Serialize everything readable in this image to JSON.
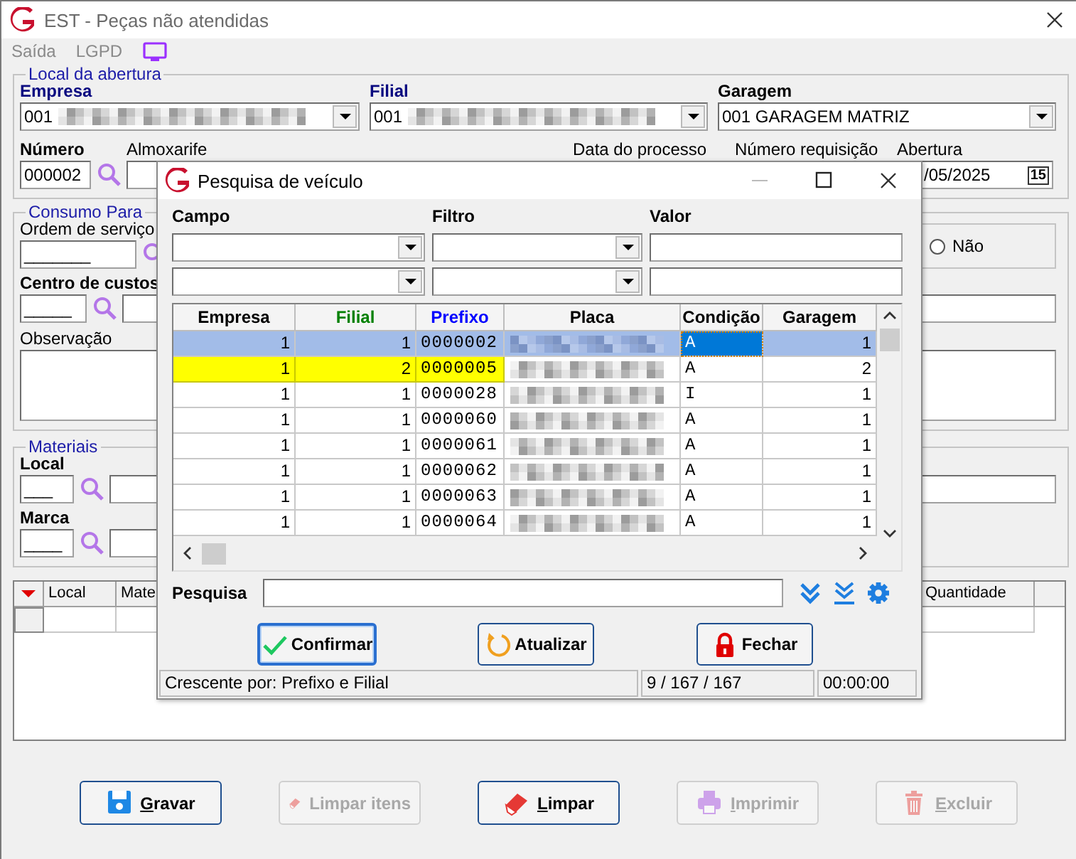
{
  "window": {
    "title": "EST - Peças não atendidas",
    "menu": [
      "Saída",
      "LGPD"
    ]
  },
  "local_da_abertura": {
    "title": "Local da abertura",
    "empresa": {
      "label": "Empresa",
      "value": "001"
    },
    "filial": {
      "label": "Filial",
      "value": "001"
    },
    "garagem": {
      "label": "Garagem",
      "value": "001 GARAGEM MATRIZ"
    },
    "numero": {
      "label": "Número",
      "value": "000002"
    },
    "almoxarife": {
      "label": "Almoxarife"
    },
    "data_do_processo": {
      "label": "Data do processo"
    },
    "numero_requisicao": {
      "label": "Número requisição"
    },
    "abertura": {
      "label": "Abertura",
      "value": "/05/2025",
      "calendar": "15"
    }
  },
  "consumo_para": {
    "title": "Consumo Para",
    "ordem_de_servico": {
      "label": "Ordem de serviço",
      "value": "_______"
    },
    "radio": {
      "label": "Não",
      "selected": false
    },
    "centro_de_custos": {
      "label": "Centro de custos",
      "value": "_____"
    },
    "observacao": {
      "label": "Observação"
    }
  },
  "materiais": {
    "title": "Materiais",
    "local": {
      "label": "Local",
      "value": "___"
    },
    "marca": {
      "label": "Marca",
      "value": "____"
    }
  },
  "items_table": {
    "columns": [
      "Local",
      "Mate",
      "Quantidade"
    ]
  },
  "buttons": [
    {
      "label": "Gravar",
      "kind": "save",
      "disabled": false,
      "accel": true
    },
    {
      "label": "Limpar itens",
      "kind": "eraser",
      "disabled": true,
      "accel": false
    },
    {
      "label": "Limpar",
      "kind": "eraser",
      "disabled": false,
      "accel": true
    },
    {
      "label": "Imprimir",
      "kind": "print",
      "disabled": true,
      "accel": true
    },
    {
      "label": "Excluir",
      "kind": "trash",
      "disabled": true,
      "accel": true
    }
  ],
  "dialog": {
    "title": "Pesquisa de veículo",
    "filter_labels": [
      "Campo",
      "Filtro",
      "Valor"
    ],
    "columns": [
      {
        "label": "Empresa",
        "color": "#000000"
      },
      {
        "label": "Filial",
        "color": "#008000"
      },
      {
        "label": "Prefixo",
        "color": "#0000ff"
      },
      {
        "label": "Placa",
        "color": "#000000"
      },
      {
        "label": "Condição",
        "color": "#000000"
      },
      {
        "label": "Garagem",
        "color": "#000000"
      }
    ],
    "rows": [
      {
        "empresa": "1",
        "filial": "1",
        "prefixo": "0000002",
        "condicao": "A",
        "garagem": "1",
        "selected": true,
        "highlighted": false
      },
      {
        "empresa": "1",
        "filial": "2",
        "prefixo": "0000005",
        "condicao": "A",
        "garagem": "2",
        "selected": false,
        "highlighted": true
      },
      {
        "empresa": "1",
        "filial": "1",
        "prefixo": "0000028",
        "condicao": "I",
        "garagem": "1",
        "selected": false,
        "highlighted": false
      },
      {
        "empresa": "1",
        "filial": "1",
        "prefixo": "0000060",
        "condicao": "A",
        "garagem": "1",
        "selected": false,
        "highlighted": false
      },
      {
        "empresa": "1",
        "filial": "1",
        "prefixo": "0000061",
        "condicao": "A",
        "garagem": "1",
        "selected": false,
        "highlighted": false
      },
      {
        "empresa": "1",
        "filial": "1",
        "prefixo": "0000062",
        "condicao": "A",
        "garagem": "1",
        "selected": false,
        "highlighted": false
      },
      {
        "empresa": "1",
        "filial": "1",
        "prefixo": "0000063",
        "condicao": "A",
        "garagem": "1",
        "selected": false,
        "highlighted": false
      },
      {
        "empresa": "1",
        "filial": "1",
        "prefixo": "0000064",
        "condicao": "A",
        "garagem": "1",
        "selected": false,
        "highlighted": false
      }
    ],
    "search": {
      "label": "Pesquisa"
    },
    "buttons": [
      {
        "label": "Confirmar",
        "kind": "confirm",
        "focused": true
      },
      {
        "label": "Atualizar",
        "kind": "refresh",
        "focused": false
      },
      {
        "label": "Fechar",
        "kind": "lock",
        "focused": false
      }
    ],
    "status": [
      "Crescente por: Prefixo e Filial",
      "9 / 167 / 167",
      "00:00:00"
    ]
  }
}
